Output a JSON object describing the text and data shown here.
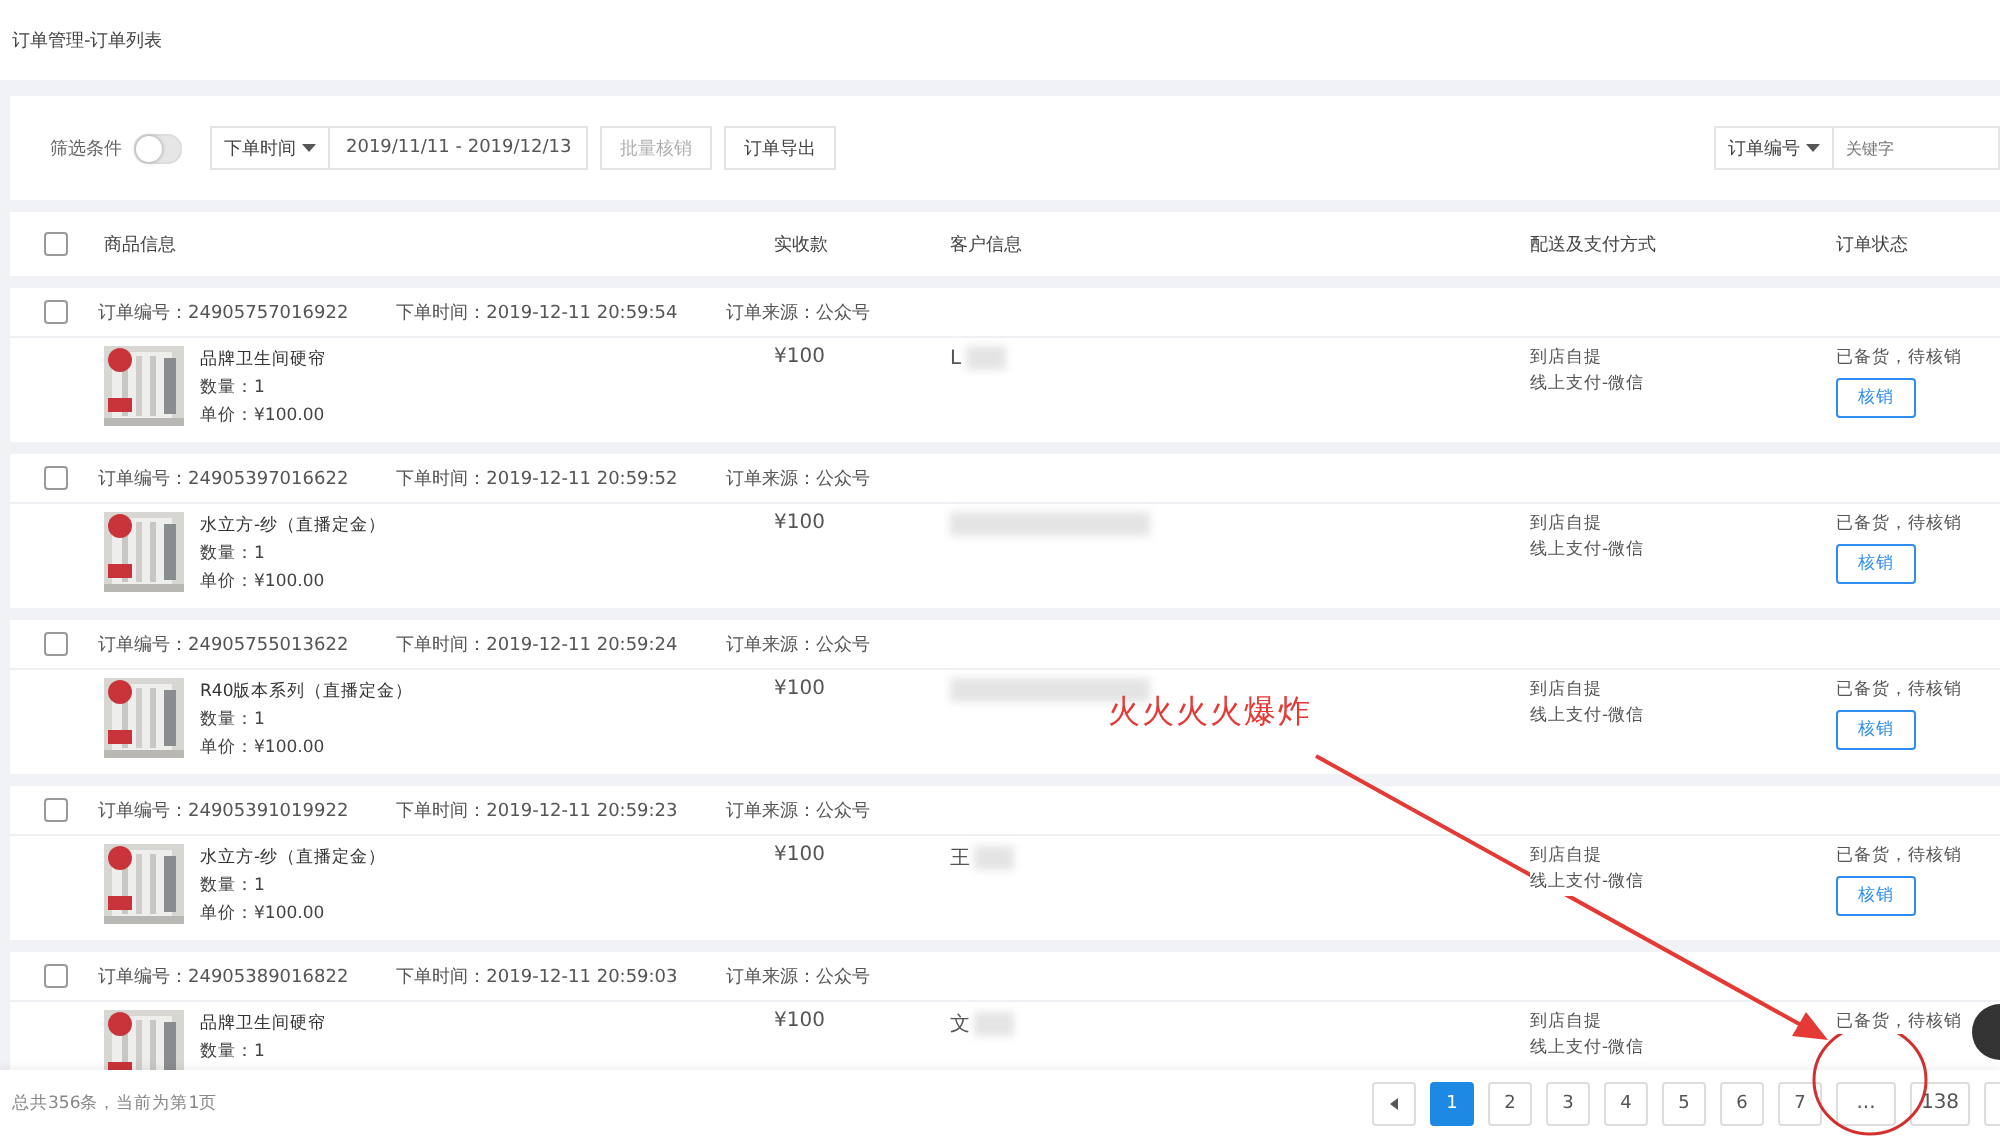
{
  "breadcrumb": "订单管理-订单列表",
  "filter": {
    "label": "筛选条件",
    "toggle_on": false,
    "time_select": "下单时间",
    "date_range": "2019/11/11 - 2019/12/13",
    "buttons": [
      {
        "label": "批量核销",
        "disabled": true
      },
      {
        "label": "订单导出",
        "disabled": false
      }
    ],
    "search_select": "订单编号",
    "search_placeholder": "关键字"
  },
  "table": {
    "select_all_checked": false,
    "columns": [
      "商品信息",
      "实收款",
      "客户信息",
      "配送及支付方式",
      "订单状态"
    ],
    "orders": [
      {
        "checked": false,
        "order_no": "订单编号：24905757016922",
        "time": "下单时间：2019-12-11 20:59:54",
        "source": "订单来源：公众号",
        "product": "品牌卫生间硬帘",
        "quantity": "数量：1",
        "price": "单价：¥100.00",
        "amount": "¥100",
        "customer": {
          "name": "L"
        },
        "delivery": "到店自提",
        "payment": "线上支付-微信",
        "status": "已备货，待核销",
        "action": "核销"
      },
      {
        "checked": false,
        "order_no": "订单编号：24905397016622",
        "time": "下单时间：2019-12-11 20:59:52",
        "source": "订单来源：公众号",
        "product": "水立方-纱（直播定金）",
        "quantity": "数量：1",
        "price": "单价：¥100.00",
        "amount": "¥100",
        "delivery": "到店自提",
        "payment": "线上支付-微信",
        "status": "已备货，待核销",
        "action": "核销"
      },
      {
        "checked": false,
        "order_no": "订单编号：24905755013622",
        "time": "下单时间：2019-12-11 20:59:24",
        "source": "订单来源：公众号",
        "product": "R40版本系列（直播定金）",
        "quantity": "数量：1",
        "price": "单价：¥100.00",
        "amount": "¥100",
        "delivery": "到店自提",
        "payment": "线上支付-微信",
        "status": "已备货，待核销",
        "action": "核销"
      },
      {
        "checked": false,
        "order_no": "订单编号：24905391019922",
        "time": "下单时间：2019-12-11 20:59:23",
        "source": "订单来源：公众号",
        "product": "水立方-纱（直播定金）",
        "quantity": "数量：1",
        "price": "单价：¥100.00",
        "amount": "¥100",
        "customer": {
          "name": "王"
        },
        "delivery": "到店自提",
        "payment": "线上支付-微信",
        "status": "已备货，待核销",
        "action": "核销"
      },
      {
        "checked": false,
        "order_no": "订单编号：24905389016822",
        "time": "下单时间：2019-12-11 20:59:03",
        "source": "订单来源：公众号",
        "product": "品牌卫生间硬帘",
        "quantity": "数量：1",
        "amount": "¥100",
        "customer": {
          "name": "文"
        },
        "delivery": "到店自提",
        "payment": "线上支付-微信",
        "status": "已备货，待核销"
      }
    ]
  },
  "footer": {
    "summary": "总共356条，当前为第1页",
    "pages": [
      {
        "label": "1",
        "selected": true
      },
      {
        "label": "2",
        "selected": false
      },
      {
        "label": "3",
        "selected": false
      },
      {
        "label": "4",
        "selected": false
      },
      {
        "label": "5",
        "selected": false
      },
      {
        "label": "6",
        "selected": false
      },
      {
        "label": "7",
        "selected": false
      },
      {
        "label": "...",
        "selected": false
      },
      {
        "label": "138",
        "selected": false
      }
    ]
  },
  "annotation": {
    "text": "火火火火爆炸"
  }
}
